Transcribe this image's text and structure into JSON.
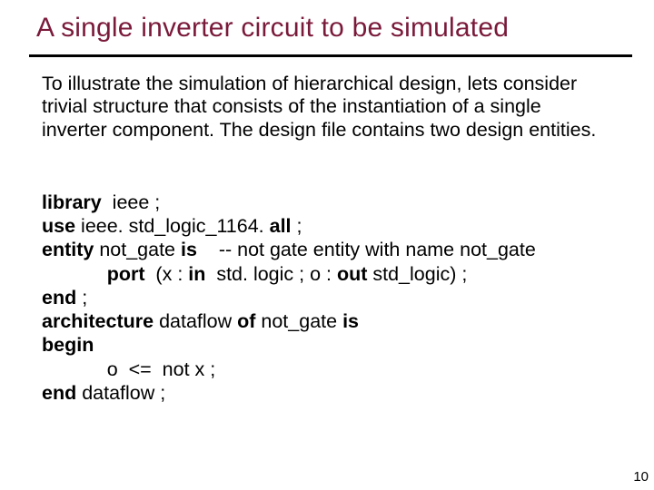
{
  "title": "A single inverter circuit to be simulated",
  "intro": "To illustrate the simulation of hierarchical design, lets consider trivial structure that consists of the instantiation of a single inverter component. The design file contains two design entities.",
  "code": {
    "kw_library": "library",
    "lib_rest": "  ieee ;",
    "kw_use": "use",
    "use_rest": " ieee. std_logic_1164. ",
    "kw_all": "all",
    "use_tail": " ;",
    "kw_entity": "entity",
    "ent_name_pre": " not_gate ",
    "kw_is": "is",
    "ent_comment": "    -- not gate entity with name not_gate",
    "kw_port": "port",
    "port_open": "  (x : ",
    "kw_in": "in",
    "port_mid": "  std. logic ; o : ",
    "kw_out": "out",
    "port_tail": " std_logic) ;",
    "kw_end1": "end",
    "end1_tail": " ;",
    "kw_arch": "architecture",
    "arch_mid": " dataflow ",
    "kw_of": "of",
    "arch_name": " not_gate ",
    "kw_is2": "is",
    "kw_begin": "begin",
    "stmt_indent": "            ",
    "stmt": "o  <=  not x ;",
    "kw_end2": "end",
    "end2_tail": " dataflow ;",
    "port_indent": "            "
  },
  "page_number": "10"
}
